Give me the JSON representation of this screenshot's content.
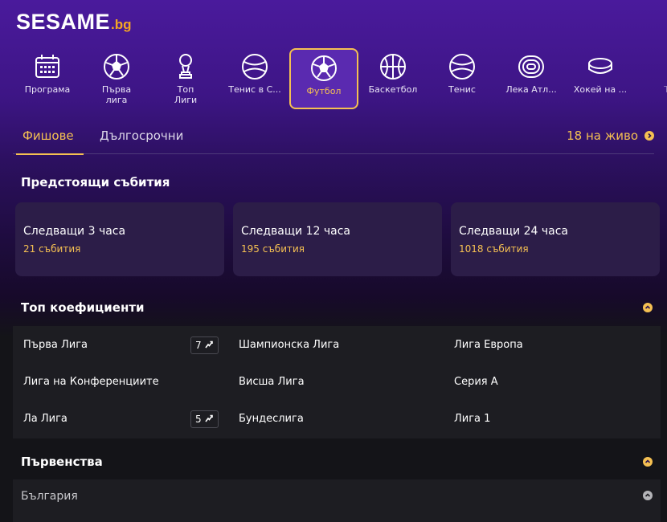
{
  "brand": {
    "name": "SESAME",
    "tld": ".bg",
    "accent": "#f5c052",
    "purple": "#4a1a9c"
  },
  "sports": [
    {
      "id": "programa",
      "label": "Програма",
      "icon": "calendar-icon"
    },
    {
      "id": "parva-liga",
      "label": "Първа\nлига",
      "icon": "soccer-ball-icon"
    },
    {
      "id": "top-ligi",
      "label": "Топ\nЛиги",
      "icon": "trophy-icon"
    },
    {
      "id": "tenis-s",
      "label": "Тенис в С...",
      "icon": "tennis-ball-icon"
    },
    {
      "id": "futbol",
      "label": "Футбол",
      "icon": "soccer-ball-icon",
      "active": true
    },
    {
      "id": "basketbol",
      "label": "Баскетбол",
      "icon": "basketball-icon"
    },
    {
      "id": "tenis",
      "label": "Тенис",
      "icon": "tennis-ball-icon"
    },
    {
      "id": "leka-atl",
      "label": "Лека Атл...",
      "icon": "running-track-icon"
    },
    {
      "id": "hokey",
      "label": "Хокей на ...",
      "icon": "hockey-puck-icon"
    },
    {
      "id": "te",
      "label": "Те",
      "icon": ""
    }
  ],
  "tabs": {
    "tickets": "Фишове",
    "longterm": "Дългосрочни"
  },
  "live": {
    "label": "18 на живо"
  },
  "upcoming": {
    "title": "Предстоящи събития",
    "cards": [
      {
        "title": "Следващи 3 часа",
        "count": "21 събития"
      },
      {
        "title": "Следващи 12 часа",
        "count": "195 събития"
      },
      {
        "title": "Следващи 24 часа",
        "count": "1018 събития"
      }
    ]
  },
  "top_odds": {
    "title": "Топ коефициенти",
    "rows": [
      [
        {
          "label": "Първа Лига",
          "badge": "7"
        },
        {
          "label": "Шампионска Лига"
        },
        {
          "label": "Лига Европа"
        }
      ],
      [
        {
          "label": "Лига на Конференциите"
        },
        {
          "label": "Висша Лига"
        },
        {
          "label": "Серия А"
        }
      ],
      [
        {
          "label": "Ла Лига",
          "badge": "5"
        },
        {
          "label": "Бундеслига"
        },
        {
          "label": "Лига 1"
        }
      ]
    ]
  },
  "championships": {
    "title": "Първенства",
    "country": "България"
  }
}
